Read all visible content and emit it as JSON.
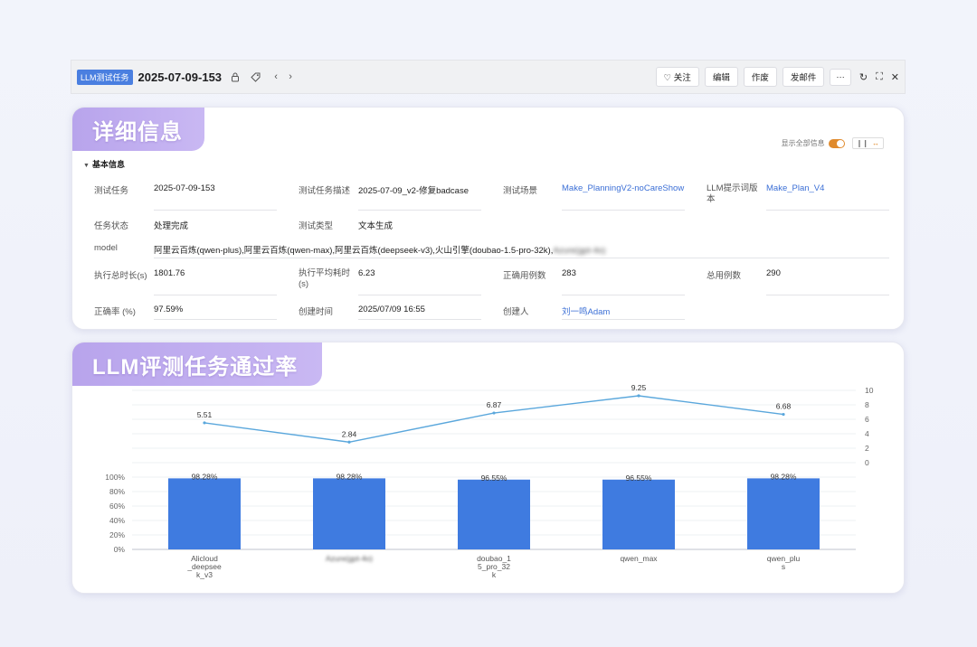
{
  "toolbar": {
    "tag": "LLM测试任务",
    "title": "2025-07-09-153",
    "buttons": [
      "♡ 关注",
      "编辑",
      "作废",
      "发邮件",
      "···"
    ],
    "icons": [
      "lock-icon",
      "tag-icon",
      "prev-icon",
      "next-icon",
      "refresh-icon",
      "fullscreen-icon",
      "close-icon"
    ]
  },
  "details": {
    "banner": "详细信息",
    "toggle_label": "显示全部信息",
    "section": "基本信息",
    "fields": [
      {
        "label": "测试任务",
        "value": "2025-07-09-153"
      },
      {
        "label": "测试任务描述",
        "value": "2025-07-09_v2-修复badcase"
      },
      {
        "label": "测试场景",
        "value": "Make_PlanningV2-noCareShow"
      },
      {
        "label": "LLM提示词版本",
        "value": "Make_Plan_V4"
      },
      {
        "label": "任务状态",
        "value": "处理完成"
      },
      {
        "label": "测试类型",
        "value": "文本生成"
      },
      {
        "label": "model",
        "value": "阿里云百炼(qwen-plus),阿里云百炼(qwen-max),阿里云百炼(deepseek-v3),火山引擎(doubao-1.5-pro-32k),"
      },
      {
        "label": "执行总时长(s)",
        "value": "1801.76"
      },
      {
        "label": "执行平均耗时(s)",
        "value": "6.23"
      },
      {
        "label": "正确用例数",
        "value": "283"
      },
      {
        "label": "总用例数",
        "value": "290"
      },
      {
        "label": "正确率 (%)",
        "value": "97.59%"
      },
      {
        "label": "创建时间",
        "value": "2025/07/09 16:55"
      },
      {
        "label": "创建人",
        "value": "刘一鸣Adam"
      }
    ]
  },
  "chart_panel": {
    "banner": "LLM评测任务通过率"
  },
  "chart_data": {
    "type": "bar",
    "categories": [
      "Alicloud_deepseek_v3",
      "Azure(gpt-4o)",
      "doubao_15_pro_32k",
      "qwen_max",
      "qwen_plus"
    ],
    "category_labels": [
      [
        "Alicloud",
        "_deepsee",
        "k_v3"
      ],
      [
        "Azure(gpt-4o)"
      ],
      [
        "doubao_1",
        "5_pro_32",
        "k"
      ],
      [
        "qwen_max"
      ],
      [
        "qwen_plu",
        "s"
      ]
    ],
    "series": [
      {
        "type": "bar",
        "values": [
          98.28,
          98.28,
          96.55,
          96.55,
          98.28
        ],
        "labels": [
          "98.28%",
          "98.28%",
          "96.55%",
          "96.55%",
          "98.28%"
        ],
        "color": "#3f7be0"
      },
      {
        "type": "line",
        "values": [
          5.51,
          2.84,
          6.87,
          9.25,
          6.68
        ],
        "labels": [
          "5.51",
          "2.84",
          "6.87",
          "9.25",
          "6.68"
        ],
        "color": "#5aa7dc"
      }
    ],
    "y_left": {
      "ticks": [
        "100%",
        "80%",
        "60%",
        "40%",
        "20%",
        "0%"
      ],
      "range": [
        0,
        100
      ]
    },
    "y_right": {
      "ticks": [
        "10",
        "8",
        "6",
        "4",
        "2",
        "0"
      ],
      "range": [
        0,
        10
      ]
    }
  }
}
